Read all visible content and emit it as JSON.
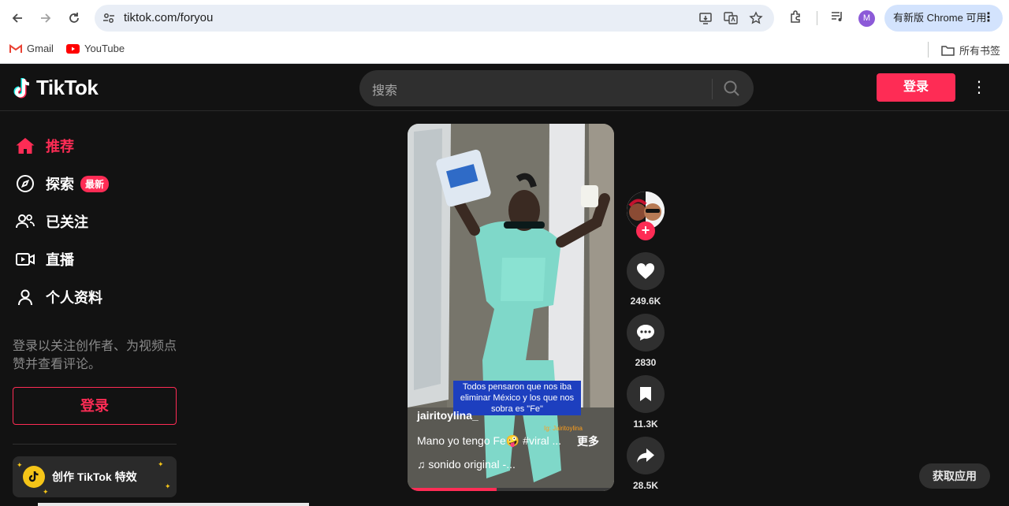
{
  "browser": {
    "url": "tiktok.com/foryou",
    "profile_initial": "M",
    "update_label": "有新版 Chrome 可用",
    "bookmarks": [
      {
        "label": "Gmail",
        "icon": "gmail-icon"
      },
      {
        "label": "YouTube",
        "icon": "youtube-icon"
      }
    ],
    "all_bookmarks_label": "所有书签"
  },
  "header": {
    "logo_text": "TikTok",
    "search_placeholder": "搜索",
    "login_label": "登录"
  },
  "sidebar": {
    "items": [
      {
        "label": "推荐",
        "icon": "home-icon",
        "active": true
      },
      {
        "label": "探索",
        "icon": "compass-icon",
        "badge": "最新"
      },
      {
        "label": "已关注",
        "icon": "following-icon"
      },
      {
        "label": "直播",
        "icon": "live-icon"
      },
      {
        "label": "个人资料",
        "icon": "profile-icon"
      }
    ],
    "hint": "登录以关注创作者、为视频点赞并查看评论。",
    "login_label": "登录",
    "creator_label": "创作 TikTok 特效"
  },
  "video": {
    "caption_overlay": "Todos pensaron que nos iba eliminar México y los que nos sobra es \"Fe\"",
    "watermark": "Ig: Jairitoylina",
    "author": "jairitoylina_",
    "description": "Mano yo tengo Fe🤪 #viral ...",
    "more_label": "更多",
    "music": "♫ sonido original -...",
    "progress_fraction": 0.43
  },
  "actions": {
    "likes": "249.6K",
    "comments": "2830",
    "saves": "11.3K",
    "shares": "28.5K"
  },
  "get_app_label": "获取应用",
  "colors": {
    "accent": "#fe2c55",
    "background": "#121212",
    "chrome_update": "#d3e3fd"
  }
}
